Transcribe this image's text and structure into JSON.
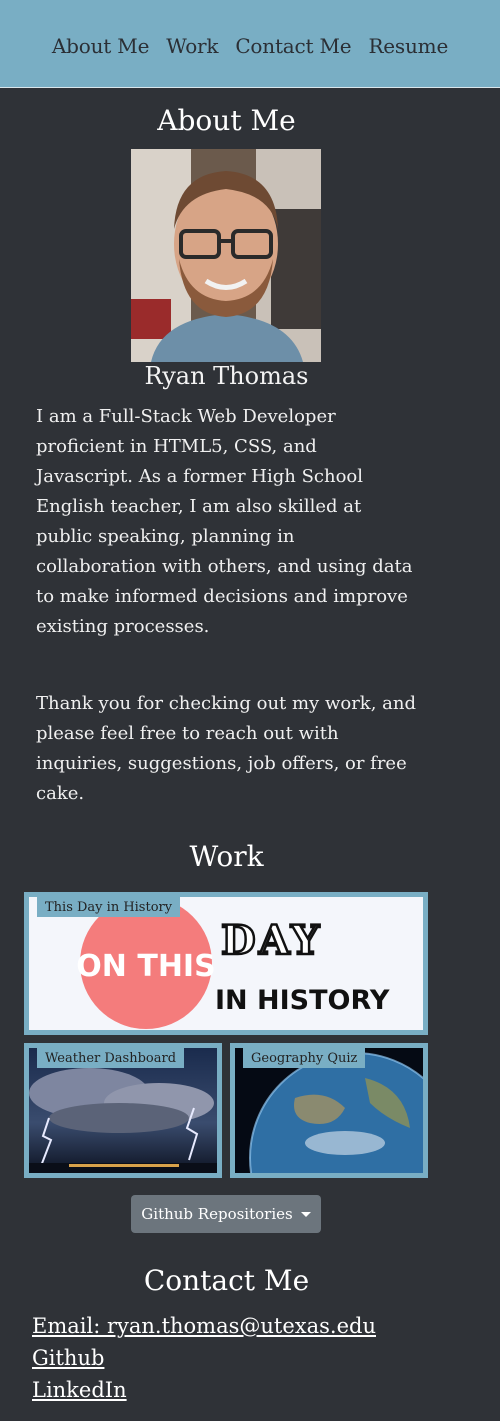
{
  "nav": {
    "items": [
      "About Me",
      "Work",
      "Contact Me",
      "Resume"
    ]
  },
  "about": {
    "title": "About Me",
    "name": "Ryan Thomas",
    "bio": [
      "I am a Full-Stack Web Developer proficient in HTML5, CSS, and Javascript. As a former High School English teacher, I am also skilled at public speaking, planning in collaboration with others, and using data to make informed decisions and improve existing processes.",
      "Thank you for checking out my work, and please feel free to reach out with inquiries, suggestions, job offers, or free cake."
    ]
  },
  "work": {
    "title": "Work",
    "projects": [
      {
        "label": "This Day in History",
        "logo_circle": "ON THIS",
        "logo_day": "DAY",
        "logo_history": "IN HISTORY"
      },
      {
        "label": "Weather Dashboard"
      },
      {
        "label": "Geography Quiz"
      }
    ],
    "dropdown_label": "Github Repositories"
  },
  "contact": {
    "title": "Contact Me",
    "links": [
      "Email: ryan.thomas@utexas.edu",
      "Github",
      "LinkedIn"
    ]
  },
  "colors": {
    "accent": "#79aec4",
    "background": "#2f3237",
    "button": "#6c757d",
    "logo_pink": "#f47c7c"
  }
}
